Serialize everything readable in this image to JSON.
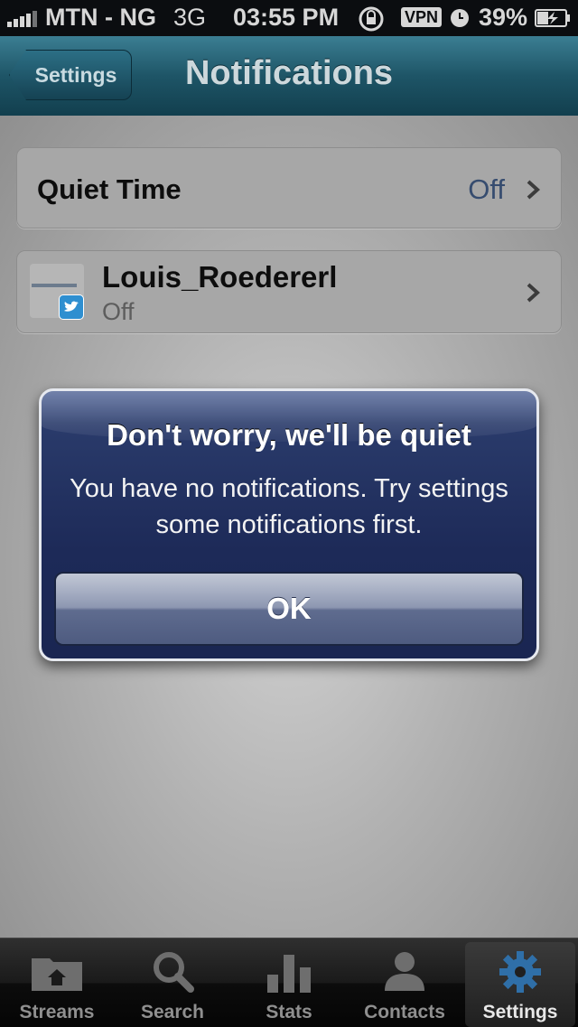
{
  "status_bar": {
    "carrier": "MTN - NG",
    "network": "3G",
    "time": "03:55 PM",
    "vpn_label": "VPN",
    "battery_percent": "39%"
  },
  "nav": {
    "back_label": "Settings",
    "title": "Notifications"
  },
  "settings": {
    "quiet_time": {
      "label": "Quiet Time",
      "value": "Off"
    },
    "account": {
      "name": "Louis_Roedererl",
      "status": "Off",
      "service_icon": "twitter-icon"
    }
  },
  "alert": {
    "title": "Don't worry, we'll be quiet",
    "message": "You have no notifications.  Try settings some notifications first.",
    "ok_label": "OK"
  },
  "tabbar": {
    "items": [
      {
        "label": "Streams",
        "icon": "streams-icon"
      },
      {
        "label": "Search",
        "icon": "search-icon"
      },
      {
        "label": "Stats",
        "icon": "stats-icon"
      },
      {
        "label": "Contacts",
        "icon": "contacts-icon"
      },
      {
        "label": "Settings",
        "icon": "settings-gear-icon",
        "active": true
      }
    ]
  },
  "colors": {
    "nav_bar": "#1e5567",
    "alert_bg": "#1d2a58",
    "settings_active_icon": "#2f6fa8"
  }
}
